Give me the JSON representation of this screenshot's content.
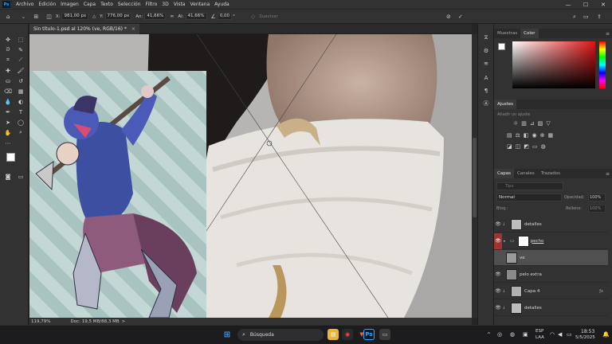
{
  "app": {
    "logo": "Ps"
  },
  "menu": [
    "Archivo",
    "Edición",
    "Imagen",
    "Capa",
    "Texto",
    "Selección",
    "Filtro",
    "3D",
    "Vista",
    "Ventana",
    "Ayuda"
  ],
  "window_controls": {
    "minimize": "—",
    "maximize": "☐",
    "close": "✕"
  },
  "options": {
    "x_label": "X:",
    "x_value": "981,00 px",
    "y_label": "Y:",
    "y_value": "776,00 px",
    "w_label": "An:",
    "w_value": "41,66%",
    "h_label": "Al:",
    "h_value": "41,66%",
    "angle_value": "0,00",
    "angle_unit": "°",
    "interp_label": "Suavizar"
  },
  "document_tab": {
    "title": "Sin título-1.psd al 120% (ve, RGB/16) *",
    "close": "×"
  },
  "status": {
    "zoom": "119,79%",
    "doc": "Doc: 19,5 MB/88,3 MB",
    "arrow": ">"
  },
  "panels": {
    "top_tabs": [
      "Muestras",
      "Color"
    ],
    "adjust_title": "Ajustes",
    "adjust_hint": "Añadir un ajuste",
    "layer_tabs": [
      "Capas",
      "Canales",
      "Trazados"
    ],
    "search_placeholder": "Tipo",
    "blend_mode": "Normal",
    "opacity_label": "Opacidad:",
    "opacity_value": "100%",
    "lock_label": "Bloq.:",
    "fill_label": "Relleno:",
    "fill_value": "100%",
    "fx_symbol": "ƒx",
    "menu_symbol": "≡"
  },
  "layers": [
    {
      "name": "detalles",
      "visible": true,
      "selected": false,
      "thumb": "#bdbdbd",
      "group": false,
      "masked": false
    },
    {
      "name": "pecho",
      "visible": true,
      "selected": false,
      "thumb": "#ffffff",
      "group": true,
      "masked": true
    },
    {
      "name": "ve",
      "visible": false,
      "selected": true,
      "thumb": "#9a9a9a",
      "group": false,
      "masked": false
    },
    {
      "name": "pelo extra",
      "visible": true,
      "selected": false,
      "thumb": "#8a8a8a",
      "group": false,
      "masked": false
    },
    {
      "name": "Capa 4",
      "visible": true,
      "selected": false,
      "thumb": "#b0b0b0",
      "group": false,
      "masked": false
    },
    {
      "name": "detalles",
      "visible": true,
      "selected": false,
      "thumb": "#bdbdbd",
      "group": false,
      "masked": false
    }
  ],
  "taskbar": {
    "search_placeholder": "Búsqueda",
    "ps_label": "Ps",
    "lang_line1": "ESP",
    "lang_line2": "LAA",
    "time": "18:53",
    "date": "5/5/2025",
    "tray_caret": "^"
  },
  "colors": {
    "accent": "#31a8ff",
    "panel": "#323232",
    "dark": "#252525",
    "highlight_red": "#a23333",
    "foreground": "#ffffff",
    "background": "#000000"
  }
}
